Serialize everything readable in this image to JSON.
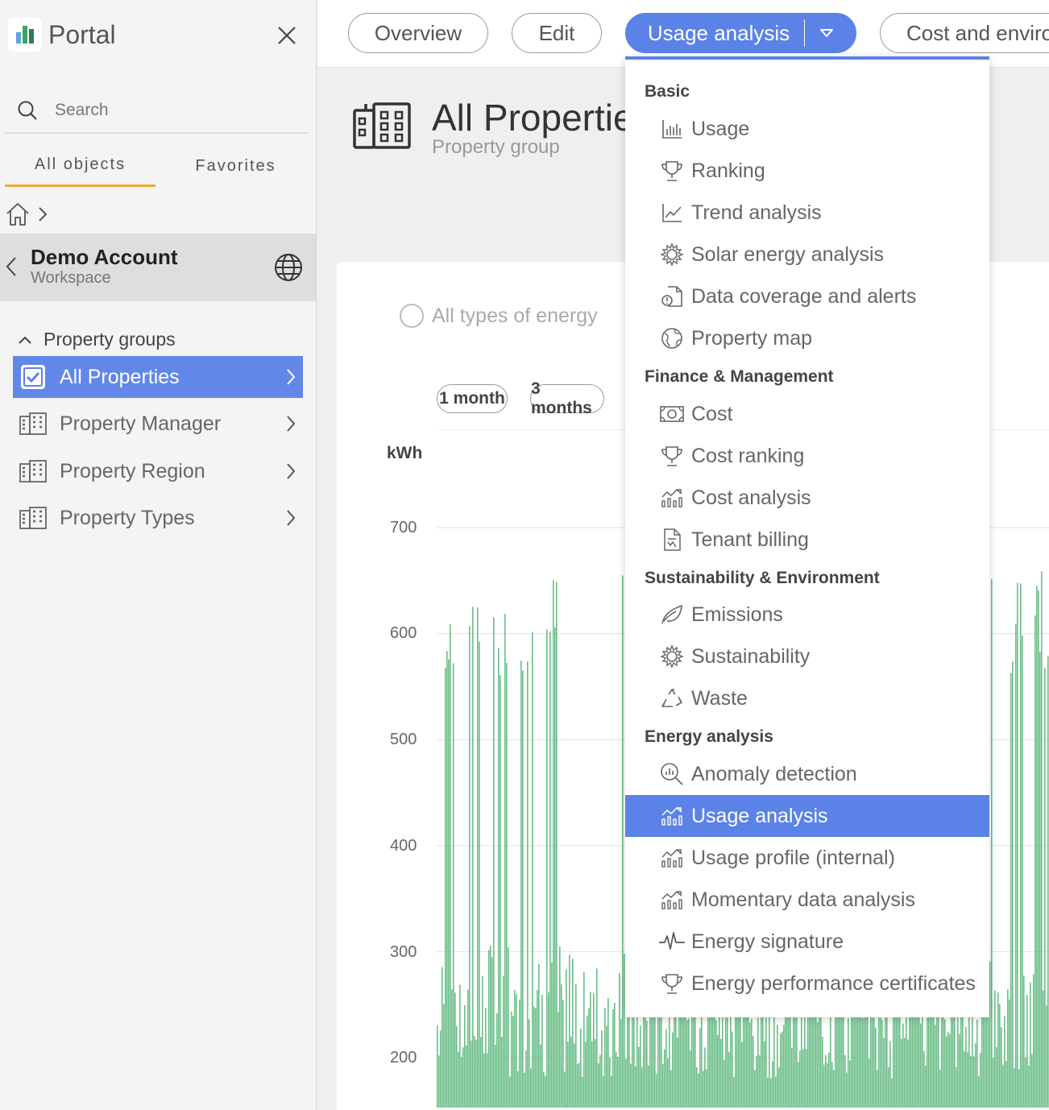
{
  "app": {
    "title": "Portal"
  },
  "sidebar": {
    "search_placeholder": "Search",
    "tabs": [
      {
        "label": "All objects",
        "active": true
      },
      {
        "label": "Favorites",
        "active": false
      }
    ],
    "account": {
      "name": "Demo Account",
      "type": "Workspace"
    },
    "groups_heading": "Property groups",
    "items": [
      {
        "label": "All Properties",
        "selected": true
      },
      {
        "label": "Property Manager",
        "selected": false
      },
      {
        "label": "Property Region",
        "selected": false
      },
      {
        "label": "Property Types",
        "selected": false
      }
    ]
  },
  "topbar": {
    "tabs": [
      {
        "label": "Overview"
      },
      {
        "label": "Edit"
      },
      {
        "label": "Usage analysis",
        "active": true
      },
      {
        "label": "Cost and environment"
      }
    ]
  },
  "main": {
    "title": "All Properties",
    "subtitle": "Property group",
    "energy_filter": "All types of energy",
    "ranges": [
      "1 month",
      "3 months"
    ]
  },
  "chart_data": {
    "type": "bar",
    "ylabel": "kWh",
    "yticks": [
      700,
      600,
      500,
      400,
      300,
      200
    ],
    "ylim": [
      150,
      780
    ],
    "bar_color": "#6cbe88",
    "description_values": "dense daily/hourly usage bars, baseline ~220-300 kWh with periodic peaks ~600-660 kWh"
  },
  "dropdown": {
    "sections": [
      {
        "heading": "Basic",
        "items": [
          {
            "label": "Usage",
            "icon": "bar-chart-icon"
          },
          {
            "label": "Ranking",
            "icon": "trophy-icon"
          },
          {
            "label": "Trend analysis",
            "icon": "trend-icon"
          },
          {
            "label": "Solar energy analysis",
            "icon": "sun-icon"
          },
          {
            "label": "Data coverage and alerts",
            "icon": "doc-alert-icon"
          },
          {
            "label": "Property map",
            "icon": "globe-map-icon"
          }
        ]
      },
      {
        "heading": "Finance & Management",
        "items": [
          {
            "label": "Cost",
            "icon": "money-icon"
          },
          {
            "label": "Cost ranking",
            "icon": "trophy-icon"
          },
          {
            "label": "Cost analysis",
            "icon": "analysis-icon"
          },
          {
            "label": "Tenant billing",
            "icon": "invoice-icon"
          }
        ]
      },
      {
        "heading": "Sustainability & Environment",
        "items": [
          {
            "label": "Emissions",
            "icon": "leaf-icon"
          },
          {
            "label": "Sustainability",
            "icon": "sun-icon"
          },
          {
            "label": "Waste",
            "icon": "recycle-icon"
          }
        ]
      },
      {
        "heading": "Energy analysis",
        "items": [
          {
            "label": "Anomaly detection",
            "icon": "magnifier-chart-icon"
          },
          {
            "label": "Usage analysis",
            "icon": "analysis-icon",
            "active": true
          },
          {
            "label": "Usage profile (internal)",
            "icon": "analysis-icon"
          },
          {
            "label": "Momentary data analysis",
            "icon": "analysis-icon"
          },
          {
            "label": "Energy signature",
            "icon": "pulse-icon"
          },
          {
            "label": "Energy performance certificates",
            "icon": "trophy-icon"
          }
        ]
      }
    ]
  },
  "colors": {
    "accent": "#5b82e6",
    "tab_underline": "#f0ab2e",
    "chart_bar": "#6cbe88"
  }
}
